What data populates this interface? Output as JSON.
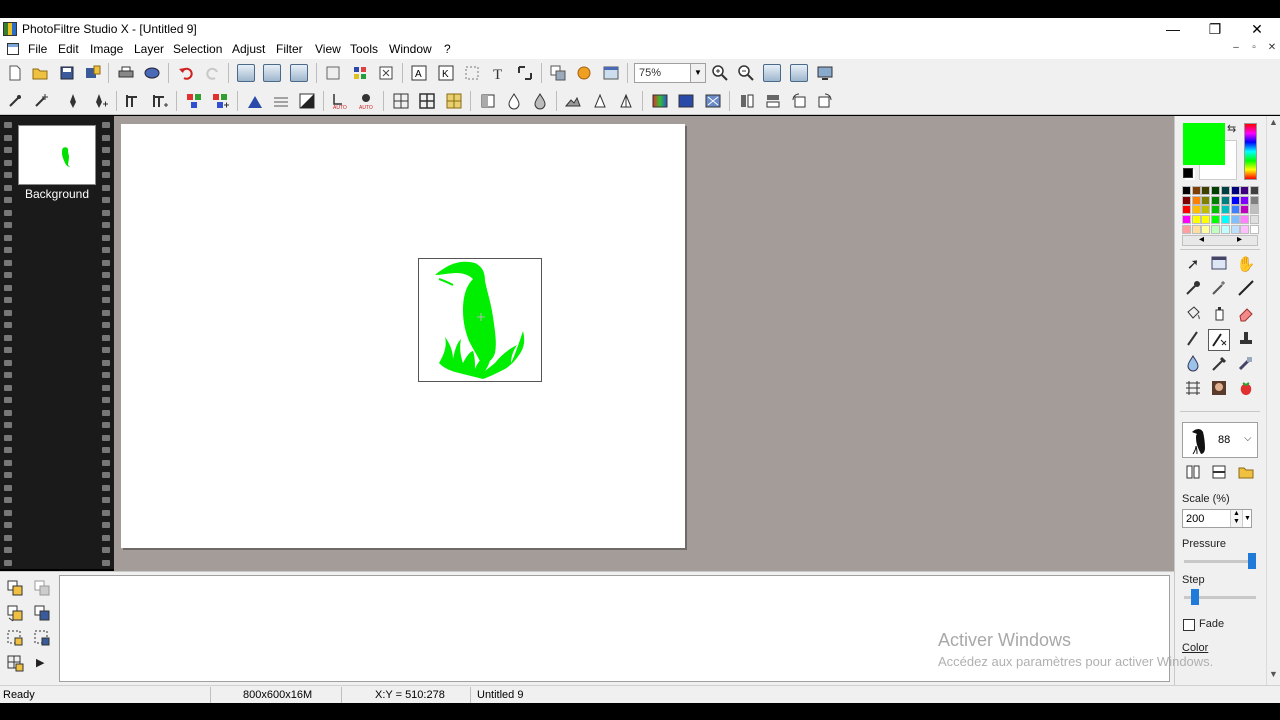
{
  "window": {
    "title": "PhotoFiltre Studio X - [Untitled 9]",
    "minimize": "—",
    "restore": "❐",
    "close": "✕",
    "doc_minimize": "–",
    "doc_restore": "▫",
    "doc_close": "✕"
  },
  "menu": {
    "items": [
      "File",
      "Edit",
      "Image",
      "Layer",
      "Selection",
      "Adjust",
      "Filter",
      "View",
      "Tools",
      "Window",
      "?"
    ]
  },
  "toolbar": {
    "zoom_value": "75%"
  },
  "filmstrip": {
    "layer_name": "Background"
  },
  "palette": {
    "foreground_color": "#00ff00",
    "background_color": "#ffffff",
    "swatches": [
      [
        "#000000",
        "#7f3f00",
        "#3f3f00",
        "#003f00",
        "#003f3f",
        "#00007f",
        "#3f007f",
        "#3f3f3f"
      ],
      [
        "#7f0000",
        "#ff7f00",
        "#7f7f00",
        "#007f00",
        "#007f7f",
        "#0000ff",
        "#7f00ff",
        "#7f7f7f"
      ],
      [
        "#ff0000",
        "#ffbf00",
        "#bfbf00",
        "#00bf00",
        "#00bfbf",
        "#3f7fff",
        "#bf00bf",
        "#bfbfbf"
      ],
      [
        "#ff00ff",
        "#ffff00",
        "#ffff00",
        "#00ff00",
        "#00ffff",
        "#7fbfff",
        "#ff7fff",
        "#dfdfdf"
      ],
      [
        "#ff9f9f",
        "#ffdf9f",
        "#ffff9f",
        "#bfffbf",
        "#bfffff",
        "#bfdfff",
        "#ffbfff",
        "#ffffff"
      ]
    ],
    "nav_left": "◂",
    "nav_right": "▸"
  },
  "brush": {
    "size": "88",
    "scale_label": "Scale (%)",
    "scale_value": "200",
    "pressure_label": "Pressure",
    "pressure_level": 0.95,
    "step_label": "Step",
    "step_level": 0.15,
    "fade_label": "Fade",
    "fade_checked": false,
    "color_link": "Color"
  },
  "status": {
    "state": "Ready",
    "image_info": "800x600x16M",
    "coords": "X:Y = 510:278",
    "doc_name": "Untitled 9"
  },
  "watermark": {
    "title": "Activer Windows",
    "subtitle": "Accédez aux paramètres pour activer Windows."
  }
}
